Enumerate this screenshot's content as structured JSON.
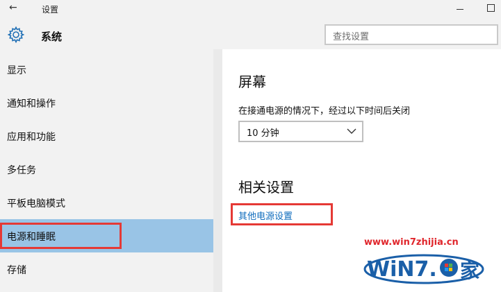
{
  "window": {
    "title": "设置",
    "back_icon": "arrow-left-icon",
    "min_icon": "minimize-icon",
    "max_icon": "maximize-icon"
  },
  "header": {
    "icon": "gear-icon",
    "title": "系统",
    "search_placeholder": "查找设置"
  },
  "sidebar": {
    "items": [
      {
        "label": "显示"
      },
      {
        "label": "通知和操作"
      },
      {
        "label": "应用和功能"
      },
      {
        "label": "多任务"
      },
      {
        "label": "平板电脑模式"
      },
      {
        "label": "电源和睡眠",
        "selected": true
      },
      {
        "label": "存储"
      }
    ]
  },
  "main": {
    "screen_heading": "屏幕",
    "screen_desc": "在接通电源的情况下，经过以下时间后关闭",
    "screen_timeout": "10 分钟",
    "related_heading": "相关设置",
    "related_link": "其他电源设置"
  },
  "watermark": {
    "url": "www.win7zhijia.cn",
    "logo_text": "WiN7.",
    "logo_char": "家"
  },
  "colors": {
    "sidebar_bg": "#f2f2f2",
    "selected_bg": "#99c4e6",
    "link": "#0f6cbd",
    "highlight": "#e53935"
  }
}
